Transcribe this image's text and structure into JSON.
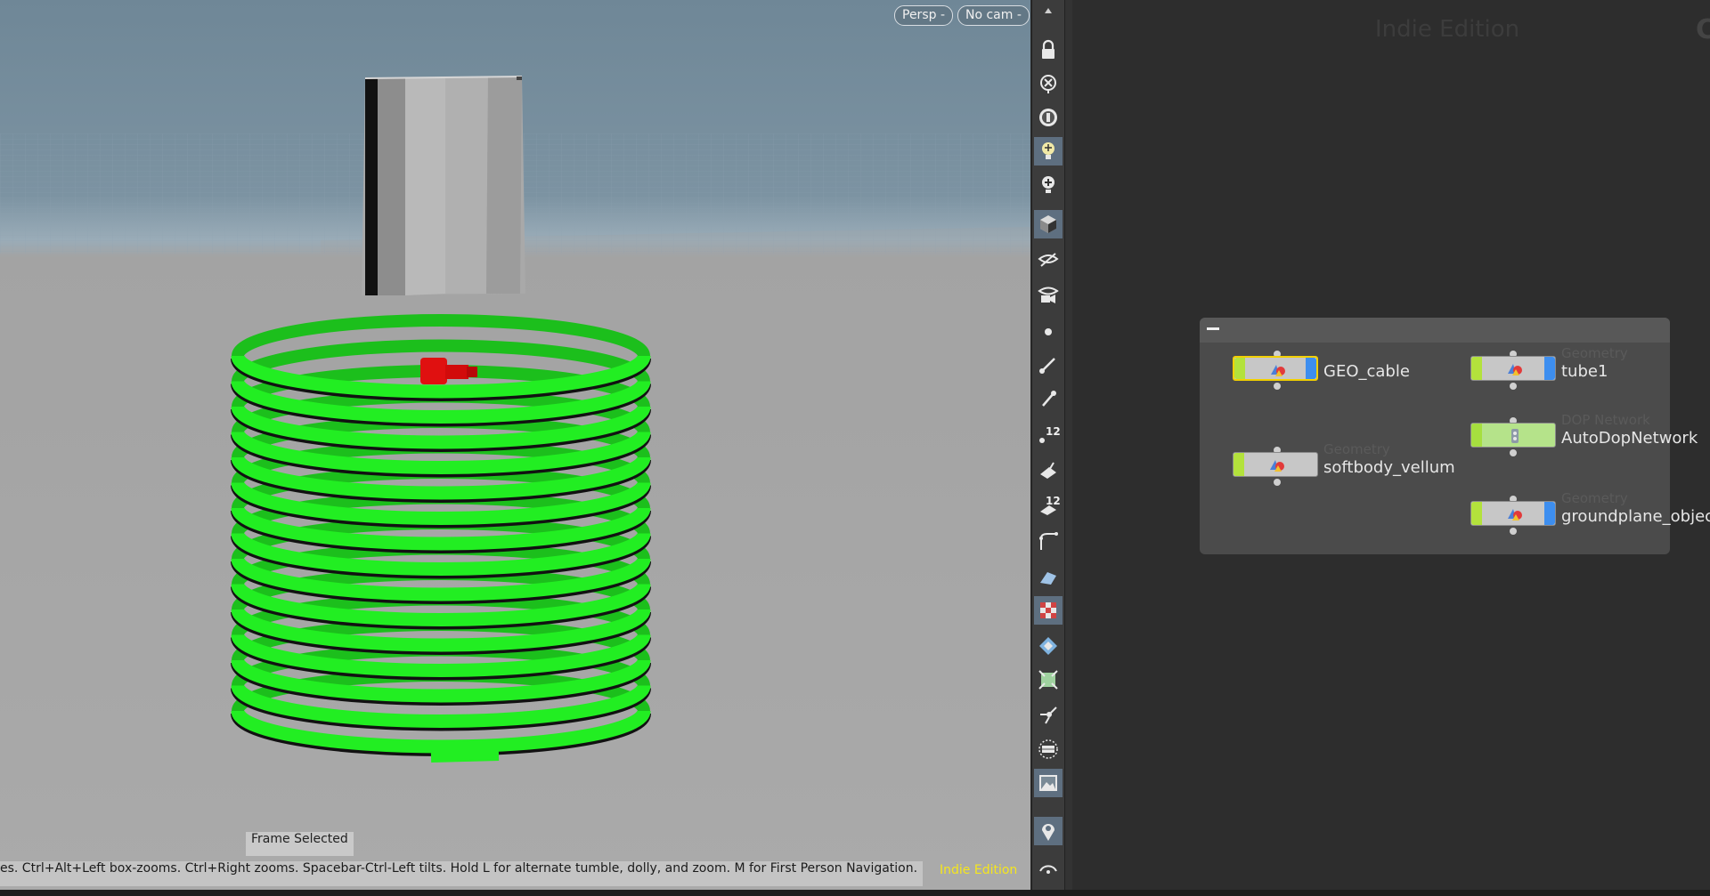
{
  "viewport": {
    "persp_label": "Persp -",
    "cam_label": "No cam -",
    "frame_selected": "Frame Selected",
    "nav_hint": "es. Ctrl+Alt+Left box-zooms. Ctrl+Right zooms. Spacebar-Ctrl-Left tilts. Hold L for alternate tumble, dolly, and zoom. M for First Person Navigation.",
    "edition": "Indie Edition",
    "colors": {
      "cable": "#22ee22",
      "tube": "#a8a8a8",
      "marker": "#e01010",
      "edition_text": "#f5e61d"
    }
  },
  "toolbar": {
    "icons": [
      "arrow-up-icon",
      "lock-icon",
      "close-circle-icon",
      "ghost-icon",
      "lightbulb-icon",
      "add-light-icon",
      "cube-shading-icon",
      "eye-hide-icon",
      "eye-camera-icon",
      "point-icon",
      "edge-icon",
      "pin-icon",
      "number-points-icon",
      "normal-icon",
      "number-prims-icon",
      "curve-icon",
      "plane-icon",
      "checker-icon",
      "diamond-icon",
      "snap-icon",
      "handle-icon",
      "box-icon",
      "background-icon",
      "location-pin-icon",
      "arc-icon"
    ],
    "numbers": {
      "points": "12",
      "prims": "12"
    }
  },
  "network": {
    "watermark": "Indie Edition",
    "corner_glyph": "C",
    "nodes": [
      {
        "id": "geo_cable",
        "name": "GEO_cable",
        "type": "",
        "kind": "geo",
        "selected": true
      },
      {
        "id": "tube1",
        "name": "tube1",
        "type": "Geometry",
        "kind": "geo",
        "selected": false
      },
      {
        "id": "autodop",
        "name": "AutoDopNetwork",
        "type": "DOP Network",
        "kind": "dop",
        "selected": false
      },
      {
        "id": "softbody",
        "name": "softbody_vellum",
        "type": "Geometry",
        "kind": "geo",
        "selected": false
      },
      {
        "id": "groundplane",
        "name": "groundplane_object",
        "type": "Geometry",
        "kind": "geo",
        "selected": false
      }
    ]
  }
}
